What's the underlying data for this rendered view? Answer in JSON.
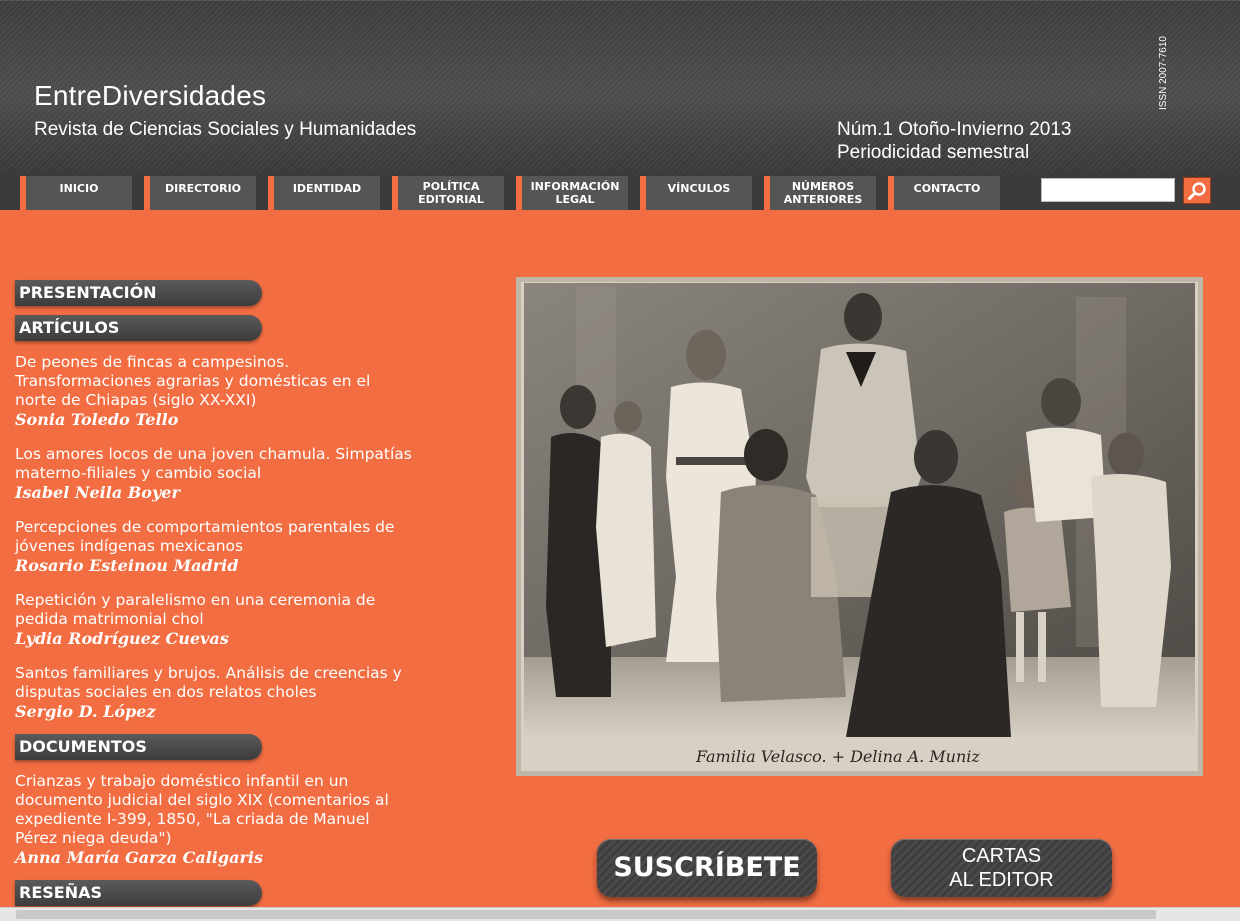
{
  "header": {
    "title": "EntreDiversidades",
    "subtitle": "Revista de Ciencias Sociales y Humanidades",
    "issue": "Núm.1 Otoño-Invierno 2013",
    "periodicity": "Periodicidad semestral",
    "issn": "ISSN 2007-7610"
  },
  "nav": {
    "items": [
      {
        "label": "INICIO"
      },
      {
        "label": "DIRECTORIO"
      },
      {
        "label": "IDENTIDAD"
      },
      {
        "label": "POLÍTICA EDITORIAL"
      },
      {
        "label": "INFORMACIÓN LEGAL"
      },
      {
        "label": "VÍNCULOS"
      },
      {
        "label": "NÚMEROS ANTERIORES"
      },
      {
        "label": "CONTACTO"
      }
    ],
    "search_value": "",
    "search_icon": "search-icon"
  },
  "sections": {
    "presentacion": "PRESENTACIÓN",
    "articulos": "ARTÍCULOS",
    "documentos": "DOCUMENTOS",
    "resenas": "RESEÑAS"
  },
  "articles": [
    {
      "title": "De peones de fincas a campesinos. Transformaciones agrarias y domésticas en el norte de Chiapas (siglo XX-XXI)",
      "author": "Sonia Toledo Tello"
    },
    {
      "title": "Los amores locos de una joven chamula. Simpatías materno-filiales y cambio social",
      "author": "Isabel Neila Boyer"
    },
    {
      "title": "Percepciones de comportamientos parentales de jóvenes indígenas mexicanos",
      "author": "Rosario Esteinou Madrid"
    },
    {
      "title": "Repetición y paralelismo en una ceremonia de pedida matrimonial chol",
      "author": "Lydia Rodríguez Cuevas"
    },
    {
      "title": "Santos familiares y brujos. Análisis de creencias y disputas sociales en dos relatos choles",
      "author": "Sergio D. López"
    }
  ],
  "documents": [
    {
      "title": "Crianzas y trabajo doméstico infantil en un documento judicial del siglo XIX (comentarios al expediente I-399, 1850, \"La criada de Manuel Pérez niega deuda\")",
      "author": "Anna María Garza Caligaris"
    }
  ],
  "photo": {
    "caption": "Familia Velasco. + Delina A. Muniz"
  },
  "buttons": {
    "suscribete": "SUSCRÍBETE",
    "cartas_line1": "CARTAS",
    "cartas_line2": "AL EDITOR"
  }
}
